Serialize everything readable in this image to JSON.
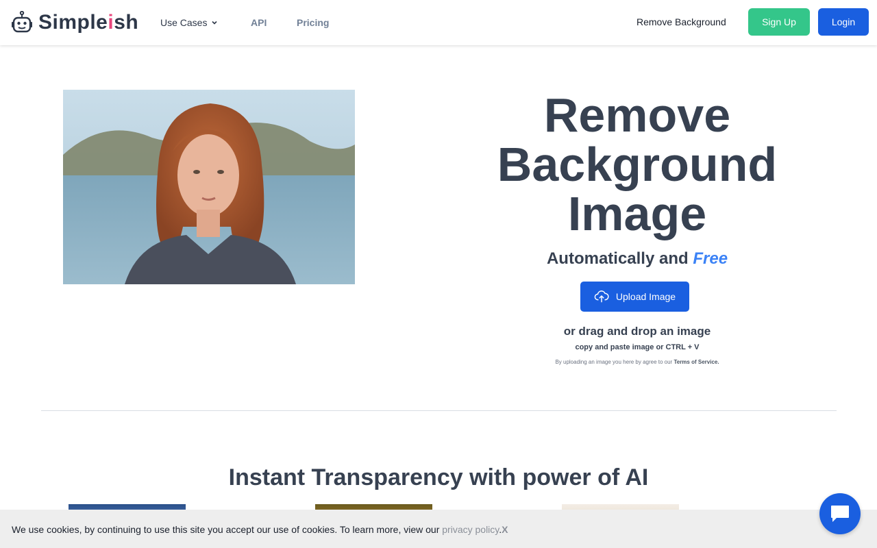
{
  "nav": {
    "logo_prefix": "Simple",
    "logo_accent": "i",
    "logo_suffix": "sh",
    "use_cases": "Use Cases",
    "api": "API",
    "pricing": "Pricing",
    "remove_background": "Remove Background",
    "sign_up": "Sign Up",
    "login": "Login"
  },
  "hero": {
    "title_line1": "Remove",
    "title_line2": "Background",
    "title_line3": "Image",
    "subtitle": "Automatically and",
    "subtitle_accent": "Free",
    "upload_button": "Upload Image",
    "drag_text": "or drag and drop an image",
    "paste_text": "copy and paste image or CTRL + V",
    "tos_text": "By uploading an image you here by agree to our",
    "tos_link": "Terms of Service."
  },
  "section": {
    "title": "Instant Transparency with power of AI"
  },
  "cookie": {
    "text": "We use cookies, by continuing to use this site you accept our use of cookies. To learn more, view our",
    "privacy_link": "privacy policy",
    "period": ".",
    "close": "X"
  },
  "colors": {
    "primary": "#1a5fe0",
    "signup": "#34c68a",
    "accent_pink": "#e8467c",
    "free_blue": "#3b82f6"
  },
  "icons": {
    "logo": "robot-icon",
    "dropdown": "chevron-down-icon",
    "upload": "cloud-upload-icon",
    "chat": "chat-bubble-icon"
  }
}
